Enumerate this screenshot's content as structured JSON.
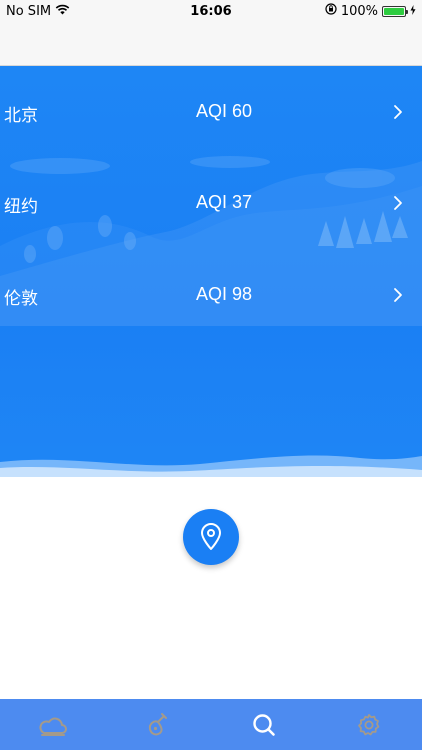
{
  "status_bar": {
    "carrier": "No SIM",
    "time": "16:06",
    "battery_text": "100%",
    "battery_level": 1.0
  },
  "cities": [
    {
      "name": "北京",
      "aqi": "AQI 60"
    },
    {
      "name": "纽约",
      "aqi": "AQI 37"
    },
    {
      "name": "伦敦",
      "aqi": "AQI 98"
    }
  ],
  "icons": {
    "wifi": "wifi-icon",
    "lock": "orientation-lock-icon",
    "battery": "battery-icon",
    "chevron": "chevron-right-icon",
    "locate": "location-pin-icon",
    "tab_weather": "cloud-icon",
    "tab_tools": "guitar-icon",
    "tab_search": "search-icon",
    "tab_settings": "gear-icon"
  },
  "colors": {
    "hero_blue": "#1a7ff4",
    "tab_bar": "#4d8bf0",
    "tab_inactive": "#a49a8a",
    "tab_active": "#ffffff"
  },
  "tab_bar": {
    "active_index": 2
  }
}
